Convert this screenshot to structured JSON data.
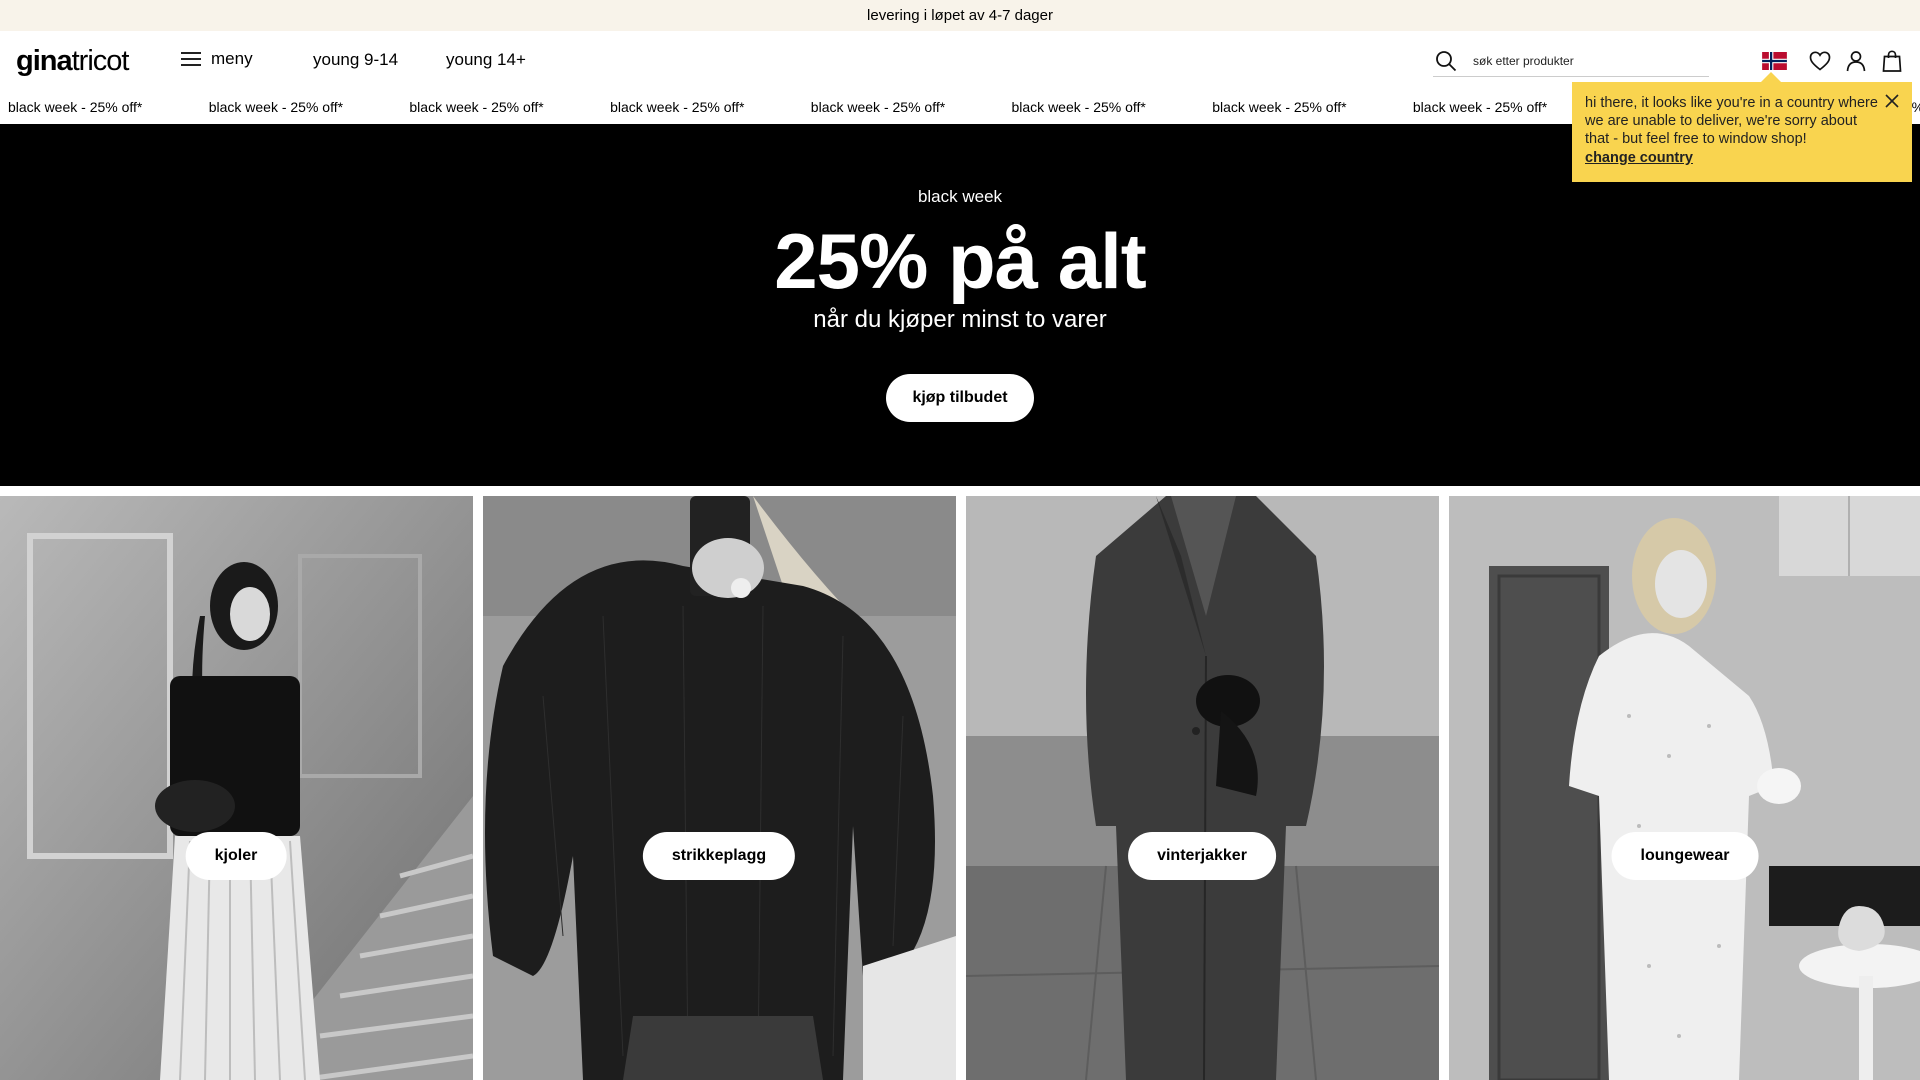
{
  "announcement": "levering i løpet av 4-7 dager",
  "header": {
    "logo_bold": "gina",
    "logo_light": "tricot",
    "menu_label": "meny",
    "nav": [
      "young 9-14",
      "young 14+"
    ],
    "search_placeholder": "søk etter produkter"
  },
  "ticker": {
    "text": "black week - 25% off*",
    "repeat_visible": 10
  },
  "hero": {
    "eyebrow": "black week",
    "title": "25% på alt",
    "subtitle": "når du kjøper minst to varer",
    "cta": "kjøp tilbudet"
  },
  "country_notice": {
    "message": "hi there, it looks like you're in a country where we are unable to deliver, we're sorry about that - but feel free to window shop!",
    "link": "change country"
  },
  "categories": [
    {
      "label": "kjoler"
    },
    {
      "label": "strikkeplagg"
    },
    {
      "label": "vinterjakker"
    },
    {
      "label": "loungewear"
    }
  ],
  "colors": {
    "announcement_bg": "#f8f3ea",
    "hero_bg": "#000000",
    "notice_bg": "#f9d44f"
  },
  "icons": [
    "menu-icon",
    "search-icon",
    "norway-flag-icon",
    "heart-icon",
    "user-icon",
    "bag-icon",
    "close-icon"
  ]
}
